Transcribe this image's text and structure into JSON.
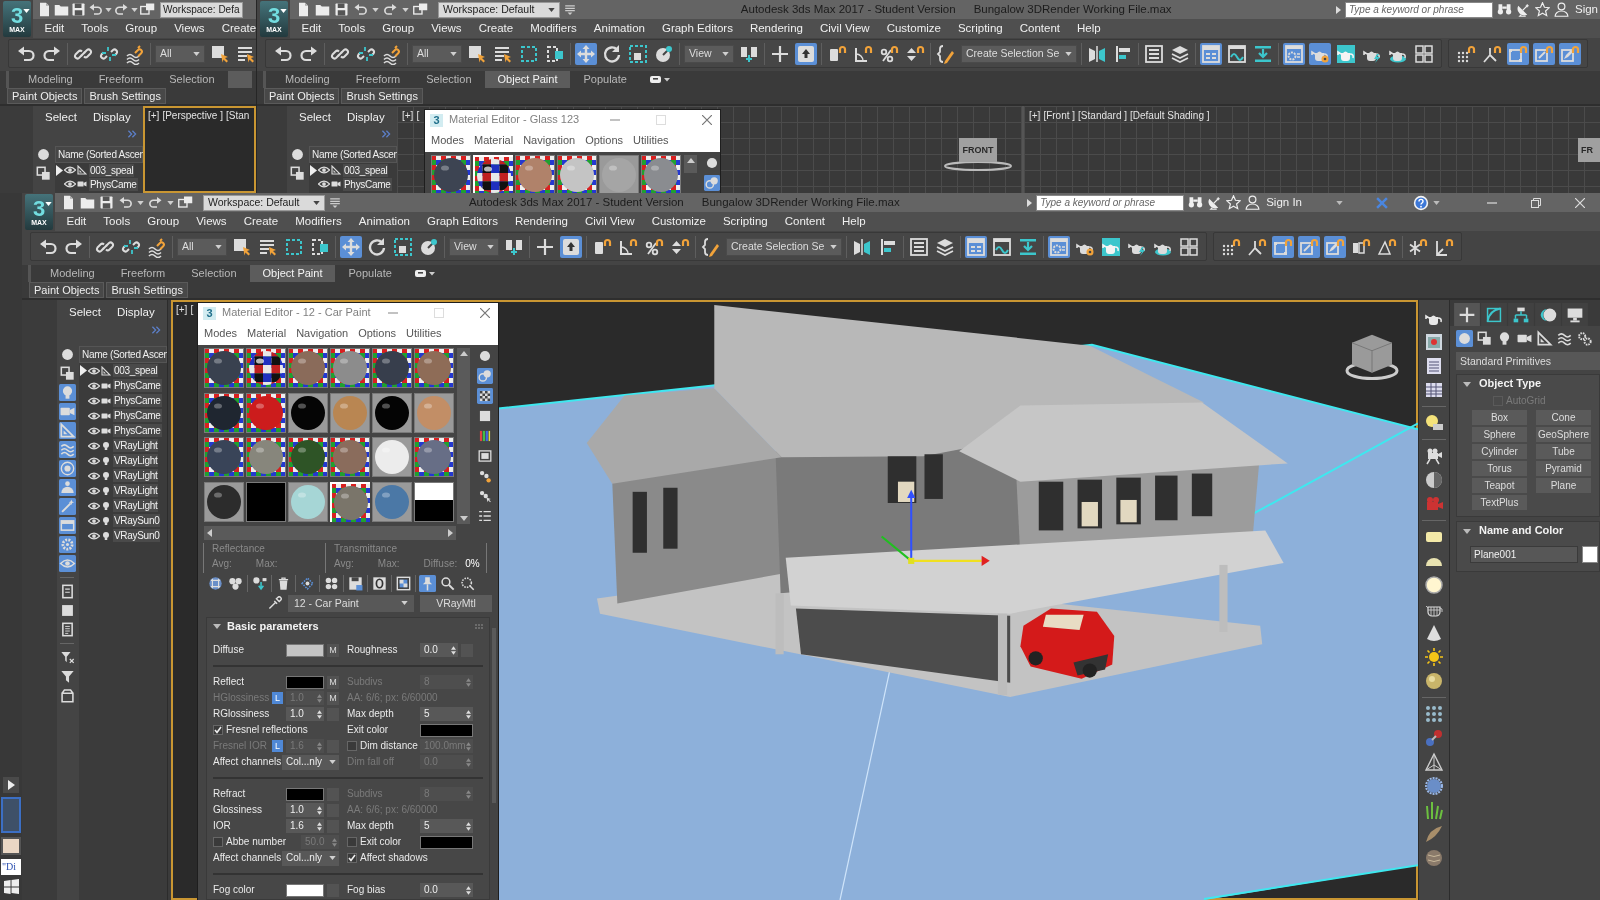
{
  "background_windows": [
    {
      "logo": {
        "digit": "3",
        "label": "MAX"
      },
      "workspace": "Workspace: Defa",
      "menus": [
        "Edit",
        "Tools",
        "Group",
        "Views",
        "Create"
      ],
      "toolbars": [
        [
          [
            {
              "kind": "button",
              "selected": false
            },
            {
              "kind": "button",
              "selected": false
            }
          ],
          [
            {
              "kind": "button",
              "selected": false
            },
            {
              "kind": "button",
              "selected": false
            },
            {
              "kind": "button",
              "selected": false
            }
          ],
          [
            {
              "kind": "dropdown",
              "label": "All"
            },
            {
              "kind": "button",
              "selected": false
            },
            {
              "kind": "button",
              "selected": false
            }
          ]
        ]
      ],
      "ribbon_tabs": [
        {
          "label": "Modeling",
          "selected": false
        },
        {
          "label": "Freeform",
          "selected": false
        },
        {
          "label": "Selection",
          "selected": false
        },
        {
          "selected": true
        }
      ],
      "ribbon_panels": [
        "Paint Objects",
        "Brush Settings"
      ],
      "explorer": {
        "tabs": [
          "Select",
          "Display"
        ],
        "column": "Name (Sorted Ascen",
        "filters": [
          [
            {
              "selected": false
            },
            {
              "selected": false
            }
          ]
        ],
        "rows": [
          {
            "name": "003_speal",
            "kind": "shape",
            "has_children": true
          },
          {
            "name": "PhysCame",
            "kind": "camera",
            "has_children": false
          }
        ]
      },
      "viewports": [
        {
          "active": true,
          "labels": [
            "[+]",
            "[Perspective ]",
            "[Stan"
          ]
        }
      ]
    },
    {
      "logo": {
        "digit": "3",
        "label": "MAX"
      },
      "workspace": "Workspace: Default",
      "title": [
        "Autodesk 3ds Max 2017 - Student Version",
        "Bungalow 3DRender Working File.max"
      ],
      "search": {
        "placeholder": "Type a keyword or phrase"
      },
      "account": "Sign",
      "menus": [
        "Edit",
        "Tools",
        "Group",
        "Views",
        "Create",
        "Modifiers",
        "Animation",
        "Graph Editors",
        "Rendering",
        "Civil View",
        "Customize",
        "Scripting",
        "Content",
        "Help"
      ],
      "toolbars": [
        [
          [
            {
              "kind": "button",
              "selected": false
            },
            {
              "kind": "button",
              "selected": false
            }
          ],
          [
            {
              "kind": "button",
              "selected": false
            },
            {
              "kind": "button",
              "selected": false
            },
            {
              "kind": "button",
              "selected": false
            }
          ],
          [
            {
              "kind": "dropdown",
              "label": "All"
            },
            {
              "kind": "button",
              "selected": false
            },
            {
              "kind": "button",
              "selected": false
            },
            {
              "kind": "button",
              "selected": false
            },
            {
              "kind": "button",
              "selected": false
            }
          ],
          [
            {
              "kind": "button",
              "selected": true
            },
            {
              "kind": "button",
              "selected": false
            },
            {
              "kind": "button",
              "selected": false
            },
            {
              "kind": "button",
              "selected": false
            }
          ],
          [
            {
              "kind": "dropdown",
              "label": "View"
            },
            {
              "kind": "button",
              "selected": false
            }
          ],
          [
            {
              "kind": "button",
              "selected": false
            },
            {
              "kind": "button",
              "selected": true
            }
          ],
          [
            {
              "kind": "button",
              "selected": false
            },
            {
              "kind": "button",
              "selected": false
            },
            {
              "kind": "button",
              "selected": false
            },
            {
              "kind": "button",
              "selected": false
            }
          ],
          [
            {
              "kind": "button",
              "selected": false
            },
            {
              "kind": "dropdown",
              "label": "Create Selection Se"
            }
          ],
          [
            {
              "kind": "button",
              "selected": false
            },
            {
              "kind": "button",
              "selected": false
            }
          ],
          [
            {
              "kind": "button",
              "selected": false
            },
            {
              "kind": "button",
              "selected": false
            }
          ],
          [
            {
              "kind": "button",
              "selected": true
            },
            {
              "kind": "button",
              "selected": false
            },
            {
              "kind": "button",
              "selected": false
            }
          ],
          [
            {
              "kind": "button",
              "selected": true
            },
            {
              "kind": "button",
              "selected": true
            },
            {
              "kind": "button",
              "selected": false
            },
            {
              "kind": "button",
              "selected": false
            },
            {
              "kind": "button",
              "selected": false
            },
            {
              "kind": "button",
              "selected": false
            }
          ]
        ],
        [
          [
            {
              "kind": "button",
              "selected": false
            },
            {
              "kind": "button",
              "selected": false
            },
            {
              "kind": "button",
              "selected": true
            },
            {
              "kind": "button",
              "selected": true
            },
            {
              "kind": "button",
              "selected": true
            }
          ]
        ]
      ],
      "ribbon_tabs": [
        {
          "label": "Modeling",
          "selected": false
        },
        {
          "label": "Freeform",
          "selected": false
        },
        {
          "label": "Selection",
          "selected": false
        },
        {
          "label": "Object Paint",
          "selected": true
        },
        {
          "label": "Populate",
          "selected": false
        }
      ],
      "ribbon_menu": true,
      "ribbon_panels": [
        "Paint Objects",
        "Brush Settings"
      ],
      "explorer": {
        "tabs": [
          "Select",
          "Display"
        ],
        "column": "Name (Sorted Ascen",
        "filters": [
          [
            {
              "selected": false
            },
            {
              "selected": false
            }
          ]
        ],
        "rows": [
          {
            "name": "003_speal",
            "kind": "shape",
            "has_children": true
          },
          {
            "name": "PhysCame",
            "kind": "camera",
            "has_children": false
          }
        ]
      },
      "viewports": [
        {
          "active": false,
          "labels": [
            "[+]",
            "["
          ],
          "viewcube": "FRONT"
        },
        {
          "active": false,
          "labels": [
            "[+]",
            "[Front ]",
            "[Standard ]",
            "[Default Shading ]"
          ],
          "viewcube": "FR"
        }
      ],
      "material_editor": {
        "app_icon": "3",
        "title": "Material Editor - Glass 123",
        "menus": [
          "Modes",
          "Material",
          "Navigation",
          "Options",
          "Utilities"
        ],
        "slots": [
          {
            "kind": "sphere",
            "color": "#3d4452",
            "checker": true,
            "selected": false
          },
          {
            "kind": "glass",
            "checker": true,
            "selected": true
          },
          {
            "kind": "sphere",
            "color": "#b0826a",
            "checker": true,
            "selected": false
          },
          {
            "kind": "sphere",
            "color": "#c4c4c4",
            "checker": true,
            "selected": false
          },
          {
            "kind": "sphere",
            "color": "#a5a5a5",
            "checker": false,
            "selected": false
          },
          {
            "kind": "sphere",
            "color": "#8a8c90",
            "checker": true,
            "selected": false
          }
        ],
        "side_tools": [
          {
            "selected": false
          },
          {
            "selected": true
          }
        ]
      }
    }
  ],
  "main_window": {
    "logo": {
      "digit": "3",
      "label": "MAX"
    },
    "workspace": "Workspace: Default",
    "title": [
      "Autodesk 3ds Max 2017 - Student Version",
      "Bungalow 3DRender Working File.max"
    ],
    "search": {
      "placeholder": "Type a keyword or phrase"
    },
    "account": "Sign In",
    "window_buttons": true,
    "menus": [
      "Edit",
      "Tools",
      "Group",
      "Views",
      "Create",
      "Modifiers",
      "Animation",
      "Graph Editors",
      "Rendering",
      "Civil View",
      "Customize",
      "Scripting",
      "Content",
      "Help"
    ],
    "toolbars": [
      [
        [
          {
            "kind": "button",
            "selected": false
          },
          {
            "kind": "button",
            "selected": false
          }
        ],
        [
          {
            "kind": "button",
            "selected": false
          },
          {
            "kind": "button",
            "selected": false
          },
          {
            "kind": "button",
            "selected": false
          }
        ],
        [
          {
            "kind": "dropdown",
            "label": "All"
          },
          {
            "kind": "button",
            "selected": false
          },
          {
            "kind": "button",
            "selected": false
          },
          {
            "kind": "button",
            "selected": false
          },
          {
            "kind": "button",
            "selected": false
          }
        ],
        [
          {
            "kind": "button",
            "selected": true
          },
          {
            "kind": "button",
            "selected": false
          },
          {
            "kind": "button",
            "selected": false
          },
          {
            "kind": "button",
            "selected": false
          }
        ],
        [
          {
            "kind": "dropdown",
            "label": "View"
          },
          {
            "kind": "button",
            "selected": false
          }
        ],
        [
          {
            "kind": "button",
            "selected": false
          },
          {
            "kind": "button",
            "selected": true
          }
        ],
        [
          {
            "kind": "button",
            "selected": false
          },
          {
            "kind": "button",
            "selected": false
          },
          {
            "kind": "button",
            "selected": false
          },
          {
            "kind": "button",
            "selected": false
          }
        ],
        [
          {
            "kind": "button",
            "selected": false
          },
          {
            "kind": "dropdown",
            "label": "Create Selection Se"
          }
        ],
        [
          {
            "kind": "button",
            "selected": false
          },
          {
            "kind": "button",
            "selected": false
          }
        ],
        [
          {
            "kind": "button",
            "selected": false
          },
          {
            "kind": "button",
            "selected": false
          }
        ],
        [
          {
            "kind": "button",
            "selected": true
          },
          {
            "kind": "button",
            "selected": false
          },
          {
            "kind": "button",
            "selected": false
          }
        ],
        [
          {
            "kind": "button",
            "selected": true
          },
          {
            "kind": "button",
            "selected": false
          },
          {
            "kind": "button",
            "selected": false
          },
          {
            "kind": "button",
            "selected": false
          },
          {
            "kind": "button",
            "selected": false
          },
          {
            "kind": "button",
            "selected": false
          }
        ]
      ],
      [
        [
          {
            "kind": "button",
            "selected": false
          },
          {
            "kind": "button",
            "selected": false
          },
          {
            "kind": "button",
            "selected": true
          },
          {
            "kind": "button",
            "selected": true
          },
          {
            "kind": "button",
            "selected": true
          },
          {
            "kind": "button",
            "selected": false
          },
          {
            "kind": "button",
            "selected": false
          }
        ],
        [
          {
            "kind": "button",
            "selected": false
          },
          {
            "kind": "button",
            "selected": false
          }
        ]
      ]
    ],
    "ribbon_tabs": [
      {
        "label": "Modeling",
        "selected": false
      },
      {
        "label": "Freeform",
        "selected": false
      },
      {
        "label": "Selection",
        "selected": false
      },
      {
        "label": "Object Paint",
        "selected": true
      },
      {
        "label": "Populate",
        "selected": false
      }
    ],
    "ribbon_menu": true,
    "ribbon_panels": [
      "Paint Objects",
      "Brush Settings"
    ],
    "explorer": {
      "tabs": [
        "Select",
        "Display"
      ],
      "column": "Name (Sorted Ascen",
      "filters": [
        [
          {
            "selected": false
          },
          {
            "selected": false
          },
          {
            "selected": true
          },
          {
            "selected": true
          },
          {
            "selected": true
          },
          {
            "selected": true
          },
          {
            "selected": true
          },
          {
            "selected": true
          },
          {
            "selected": true
          },
          {
            "selected": true
          },
          {
            "selected": true
          },
          {
            "selected": true
          }
        ],
        [
          {
            "selected": false
          },
          {
            "selected": false
          },
          {
            "selected": false
          }
        ],
        [
          {
            "selected": false
          },
          {
            "selected": false
          },
          {
            "selected": false
          }
        ]
      ],
      "rows": [
        {
          "name": "003_speal",
          "kind": "shape",
          "has_children": true
        },
        {
          "name": "PhysCame",
          "kind": "camera",
          "has_children": false
        },
        {
          "name": "PhysCame",
          "kind": "camera",
          "has_children": false
        },
        {
          "name": "PhysCame",
          "kind": "camera",
          "has_children": false
        },
        {
          "name": "PhysCame",
          "kind": "camera",
          "has_children": false
        },
        {
          "name": "VRayLight",
          "kind": "light",
          "has_children": false
        },
        {
          "name": "VRayLight",
          "kind": "light",
          "has_children": false
        },
        {
          "name": "VRayLight",
          "kind": "light",
          "has_children": false
        },
        {
          "name": "VRayLight",
          "kind": "light",
          "has_children": false
        },
        {
          "name": "VRayLight",
          "kind": "light",
          "has_children": false
        },
        {
          "name": "VRaySun0",
          "kind": "light",
          "has_children": false
        },
        {
          "name": "VRaySun0",
          "kind": "light",
          "has_children": false
        }
      ]
    },
    "viewports": [
      {
        "active": true,
        "labels": [
          "[+]",
          "["
        ]
      }
    ],
    "material_editor": {
      "app_icon": "3",
      "title": "Material Editor - 12 - Car Paint",
      "menus": [
        "Modes",
        "Material",
        "Navigation",
        "Options",
        "Utilities"
      ],
      "slots": [
        {
          "kind": "sphere",
          "color": "#39414f",
          "checker": true,
          "selected": false
        },
        {
          "kind": "glass",
          "checker": true,
          "selected": false
        },
        {
          "kind": "sphere",
          "color": "#8a6b5a",
          "checker": true,
          "selected": false
        },
        {
          "kind": "sphere",
          "color": "#8c8c8c",
          "checker": true,
          "selected": false
        },
        {
          "kind": "sphere",
          "color": "#373e4c",
          "checker": true,
          "selected": false
        },
        {
          "kind": "sphere",
          "color": "#8e6c57",
          "checker": true,
          "selected": false
        },
        {
          "kind": "sphere",
          "color": "#1f2630",
          "checker": true,
          "selected": false
        },
        {
          "kind": "sphere",
          "color": "#cc1c1c",
          "checker": true,
          "selected": false
        },
        {
          "kind": "sphere",
          "color": "#050505",
          "checker": false,
          "selected": false
        },
        {
          "kind": "sphere",
          "color": "#b98652",
          "checker": false,
          "selected": false
        },
        {
          "kind": "sphere",
          "color": "#040404",
          "checker": false,
          "selected": false
        },
        {
          "kind": "sphere",
          "color": "#c28e66",
          "checker": false,
          "selected": false
        },
        {
          "kind": "sphere",
          "color": "#394458",
          "checker": true,
          "selected": false
        },
        {
          "kind": "sphere",
          "color": "#87867c",
          "checker": true,
          "selected": false
        },
        {
          "kind": "sphere",
          "color": "#2e5426",
          "checker": true,
          "selected": false
        },
        {
          "kind": "sphere",
          "color": "#8a6c5c",
          "checker": true,
          "selected": false
        },
        {
          "kind": "sphere",
          "color": "#ececec",
          "checker": false,
          "selected": false
        },
        {
          "kind": "sphere",
          "color": "#676e86",
          "checker": true,
          "selected": false
        },
        {
          "kind": "sphere",
          "color": "#2c2c2c",
          "checker": false,
          "selected": false
        },
        {
          "kind": "flat",
          "color": "#000000",
          "selected": false
        },
        {
          "kind": "sphere",
          "color": "#a6d6d6",
          "checker": false,
          "selected": false
        },
        {
          "kind": "sphere",
          "color": "#7a756a",
          "checker": true,
          "selected": true
        },
        {
          "kind": "sphere",
          "color": "#4b78a6",
          "checker": false,
          "selected": false
        },
        {
          "kind": "split",
          "selected": false
        }
      ],
      "side_tools": [
        {
          "selected": false
        },
        {
          "selected": true
        },
        {
          "selected": true
        },
        {
          "selected": false
        },
        {
          "selected": false
        },
        {
          "selected": false
        },
        {
          "selected": false
        },
        {
          "selected": false
        },
        {
          "selected": false
        }
      ],
      "stats": [
        {
          "title": "Reflectance",
          "fields": [
            {
              "label": "Avg:"
            },
            {
              "label": "Max:"
            }
          ]
        },
        {
          "title": "Transmittance",
          "fields": [
            {
              "label": "Avg:"
            },
            {
              "label": "Max:"
            },
            {
              "label": "Diffuse:",
              "value": "0%"
            }
          ]
        }
      ],
      "tools": [
        [
          {
            "selected": false
          },
          {
            "selected": false
          }
        ],
        [
          {
            "selected": false
          }
        ],
        [
          {
            "selected": false
          }
        ],
        [
          {
            "selected": false
          }
        ],
        [
          {
            "selected": false
          }
        ],
        [
          {
            "selected": false
          }
        ],
        [
          {
            "selected": false
          }
        ],
        [
          {
            "selected": false
          }
        ],
        [
          {
            "selected": true
          },
          {
            "selected": false
          },
          {
            "selected": false
          }
        ]
      ],
      "material_name": "12 - Car Paint",
      "material_type": "VRayMtl",
      "rollout": {
        "title": "Basic parameters",
        "expanded": true,
        "groups": [
          [
            {
              "left": {
                "kind": "color",
                "label": "Diffuse",
                "color": "#c4c4c4",
                "map_button": true,
                "map_label": "M",
                "disabled": false
              },
              "right": {
                "kind": "spinner",
                "label": "Roughness",
                "value": "0.0",
                "map_button": true,
                "disabled": false
              }
            }
          ],
          [
            {
              "left": {
                "kind": "color",
                "label": "Reflect",
                "color": "#000000",
                "map_button": true,
                "map_label": "M",
                "disabled": false
              },
              "right": {
                "kind": "spinner",
                "label": "Subdivs",
                "value": "8",
                "disabled": true
              }
            },
            {
              "left": {
                "kind": "spinner",
                "label": "HGlossiness",
                "lock": "L",
                "value": "1.0",
                "map_button": true,
                "map_label": "M",
                "disabled": true
              },
              "right": {
                "kind": "note",
                "label": "AA: 6/6; px: 6/60000",
                "disabled": true
              }
            },
            {
              "left": {
                "kind": "spinner",
                "label": "RGlossiness",
                "value": "1.0",
                "map_button": true,
                "disabled": false
              },
              "right": {
                "kind": "spinner",
                "label": "Max depth",
                "value": "5",
                "disabled": false
              }
            },
            {
              "left": {
                "kind": "check",
                "label": "Fresnel reflections",
                "checked": true,
                "disabled": false
              },
              "right": {
                "kind": "color",
                "label": "Exit color",
                "color": "#000000",
                "disabled": false
              }
            },
            {
              "left": {
                "kind": "spinner",
                "label": "Fresnel IOR",
                "lock": "L",
                "value": "1.6",
                "map_button": true,
                "disabled": true
              },
              "right": {
                "kind": "spinner",
                "label": "Dim distance",
                "checked": false,
                "value": "100.0mm",
                "disabled": false
              }
            },
            {
              "left": {
                "kind": "dropdown",
                "label": "Affect channels",
                "value": "Col...nly",
                "disabled": false
              },
              "right": {
                "kind": "spinner",
                "label": "Dim fall off",
                "value": "0.0",
                "disabled": true
              }
            }
          ],
          [
            {
              "left": {
                "kind": "color",
                "label": "Refract",
                "color": "#000000",
                "map_button": true,
                "disabled": false
              },
              "right": {
                "kind": "spinner",
                "label": "Subdivs",
                "value": "8",
                "disabled": true
              }
            },
            {
              "left": {
                "kind": "spinner",
                "label": "Glossiness",
                "value": "1.0",
                "map_button": true,
                "disabled": false
              },
              "right": {
                "kind": "note",
                "label": "AA: 6/6; px: 6/60000",
                "disabled": true
              }
            },
            {
              "left": {
                "kind": "spinner",
                "label": "IOR",
                "value": "1.6",
                "map_button": true,
                "disabled": false
              },
              "right": {
                "kind": "spinner",
                "label": "Max depth",
                "value": "5",
                "disabled": false
              }
            },
            {
              "left": {
                "kind": "spinner",
                "label": "Abbe number",
                "checked": false,
                "value": "50.0",
                "disabled": false
              },
              "right": {
                "kind": "color",
                "label": "Exit color",
                "checked": false,
                "color": "#000000",
                "disabled": false
              }
            },
            {
              "left": {
                "kind": "dropdown",
                "label": "Affect channels",
                "value": "Col...nly",
                "disabled": false
              },
              "right": {
                "kind": "check",
                "label": "Affect shadows",
                "checked": true,
                "disabled": false
              }
            }
          ],
          [
            {
              "left": {
                "kind": "color",
                "label": "Fog color",
                "color": "#ffffff",
                "map_button": true,
                "disabled": false
              },
              "right": {
                "kind": "spinner",
                "label": "Fog bias",
                "value": "0.0",
                "disabled": false
              }
            }
          ]
        ]
      }
    },
    "command_panel": {
      "tabs": [
        {
          "selected": true
        },
        {
          "selected": false
        },
        {
          "selected": false
        },
        {
          "selected": false
        },
        {
          "selected": false
        }
      ],
      "categories": [
        {
          "selected": true
        },
        {
          "selected": false
        },
        {
          "selected": false
        },
        {
          "selected": false
        },
        {
          "selected": false
        },
        {
          "selected": false
        },
        {
          "selected": false
        }
      ],
      "category_list": "Standard Primitives",
      "rollouts": [
        {
          "kind": "buttons",
          "title": "Object Type",
          "expanded": true,
          "option": {
            "label": "AutoGrid",
            "checked": false,
            "disabled": true
          },
          "buttons": [
            "Box",
            "Cone",
            "Sphere",
            "GeoSphere",
            "Cylinder",
            "Tube",
            "Torus",
            "Pyramid",
            "Teapot",
            "Plane",
            "TextPlus"
          ]
        },
        {
          "kind": "name",
          "title": "Name and Color",
          "expanded": true,
          "value": "Plane001",
          "color": "#ffffff"
        }
      ]
    }
  },
  "taskbar": {
    "items": [
      {
        "kind": "preview",
        "color": "#3e5068",
        "selected": true
      },
      {
        "kind": "preview",
        "color": "#ead7c4",
        "selected": false
      },
      {
        "kind": "document",
        "label": "\"Di",
        "selected": false
      }
    ]
  }
}
